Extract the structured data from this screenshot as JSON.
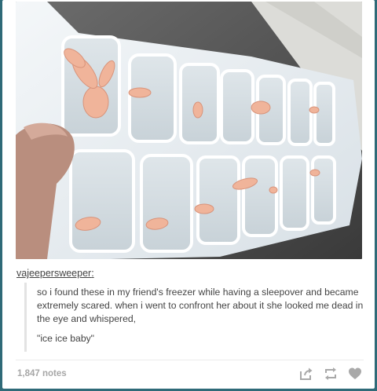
{
  "post": {
    "username": "vajeepersweeper",
    "username_suffix": ":",
    "quote_text": "so i found these in my friend's freezer while having a sleepover and became extremely scared. when i went to confront her about it she looked me dead in the eye and whispered,",
    "quote_text2": "\"ice ice baby\""
  },
  "footer": {
    "notes": "1,847 notes",
    "icons": [
      "share-icon",
      "reblog-icon",
      "like-heart-icon"
    ]
  },
  "colors": {
    "background": "#2f6a78",
    "card": "#ffffff",
    "text": "#444444",
    "muted": "#a7a7a7",
    "tray": "#e9eef2",
    "baby_skin": "#f0b49a"
  }
}
